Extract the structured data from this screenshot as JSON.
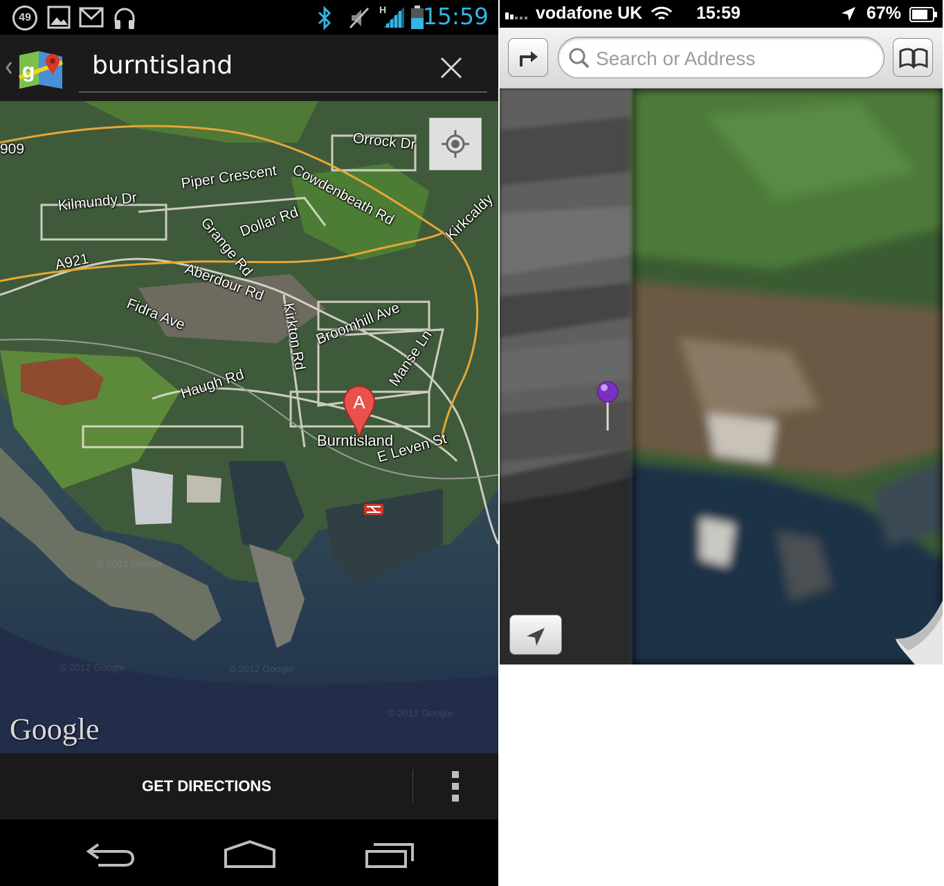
{
  "android": {
    "status_bar": {
      "notification_count": "49",
      "time": "15:59",
      "network_type": "H",
      "icons": [
        "notification-count-icon",
        "image-icon",
        "gmail-icon",
        "headphones-icon",
        "bluetooth-icon",
        "vibrate-icon",
        "signal-icon",
        "battery-icon"
      ]
    },
    "action_bar": {
      "app_icon": "google-maps-icon",
      "search_value": "burntisland",
      "clear_icon": "close-icon"
    },
    "map": {
      "labels": {
        "road_909": "909",
        "orrock_dr": "Orrock Dr",
        "cowdenbeath_rd": "Cowdenbeath Rd",
        "piper_crescent": "Piper Crescent",
        "kilmundy_dr": "Kilmundy Dr",
        "grange_rd": "Grange Rd",
        "dollar_rd": "Dollar Rd",
        "kirkcaldy": "Kirkcaldy",
        "a921": "A921",
        "aberdour_rd": "Aberdour Rd",
        "fidra_ave": "Fidra Ave",
        "kirkton_rd": "Kirkton Rd",
        "broomhill_ave": "Broomhill Ave",
        "manse_ln": "Manse Ln",
        "haugh_rd": "Haugh Rd",
        "place": "Burntisland",
        "e_leven_st": "E Leven St"
      },
      "marker_letter": "A",
      "copyright": "© 2012 Google",
      "logo": "Google"
    },
    "bottom_bar": {
      "get_directions": "GET DIRECTIONS"
    },
    "nav_bar": [
      "back-icon",
      "home-icon",
      "recent-apps-icon"
    ]
  },
  "ios": {
    "status_bar": {
      "carrier": "vodafone UK",
      "time": "15:59",
      "battery": "67%"
    },
    "toolbar": {
      "search_placeholder": "Search or Address"
    },
    "colors": {
      "android_accent": "#33b5e5",
      "ios_pin": "#7a2ec2"
    }
  }
}
